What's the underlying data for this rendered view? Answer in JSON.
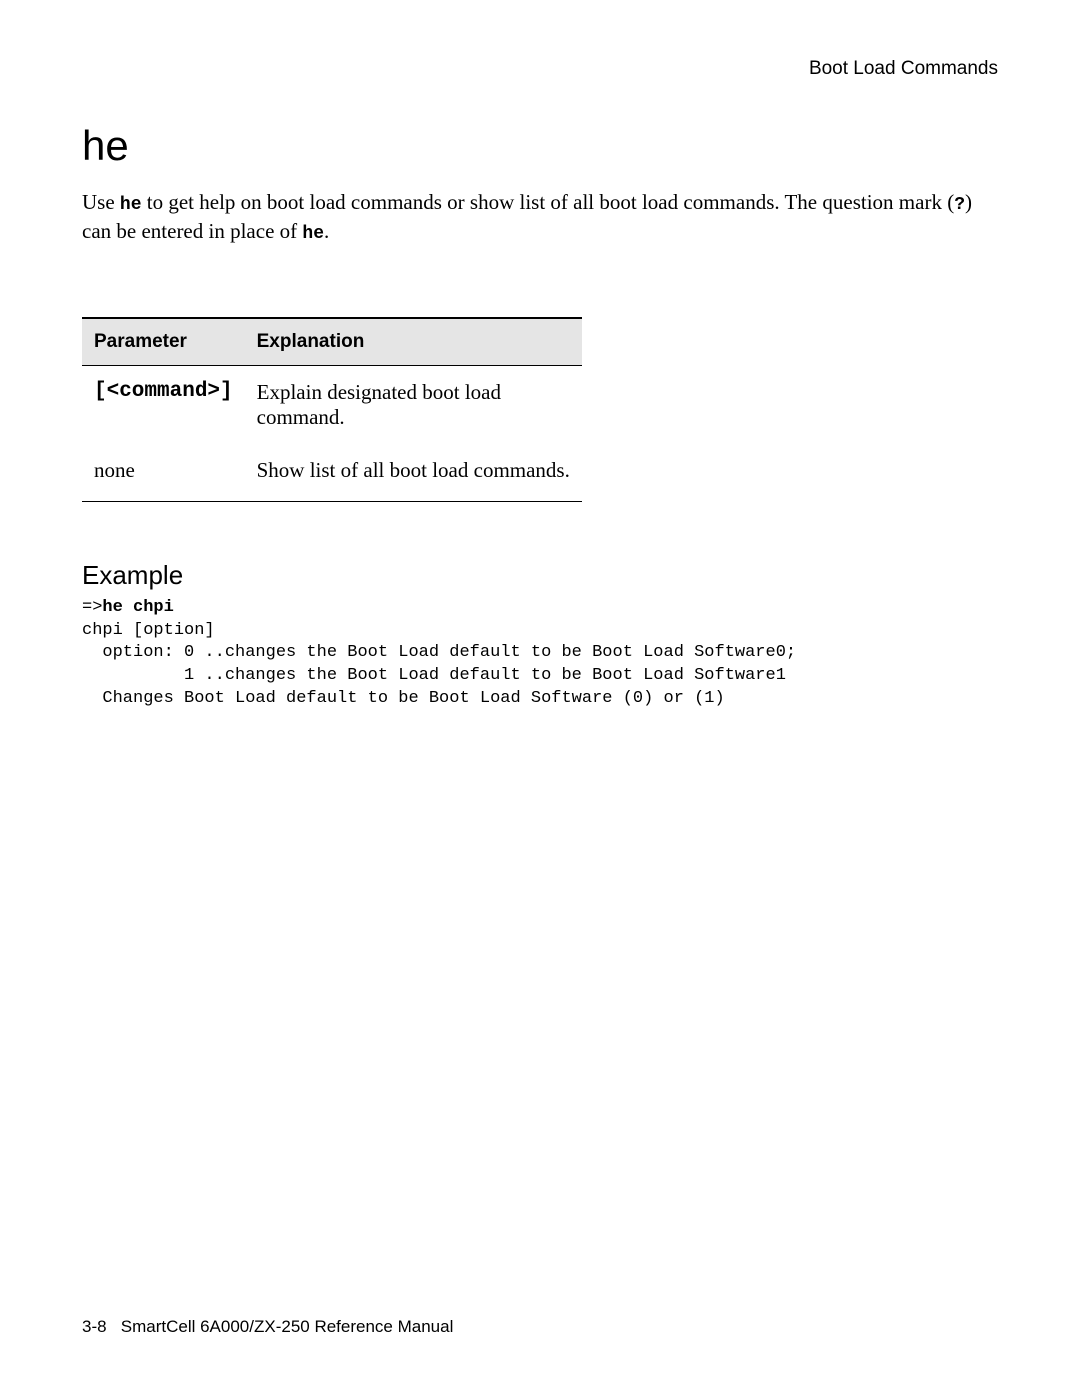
{
  "header": {
    "section": "Boot Load Commands"
  },
  "title": "he",
  "intro": {
    "pre1": "Use ",
    "cmd1": "he",
    "mid1": " to get help on boot load commands or show list of all boot load commands. The question mark (",
    "qmark": "?",
    "mid2": ") can be entered in place of ",
    "cmd2": "he",
    "post": "."
  },
  "table": {
    "headers": {
      "param": "Parameter",
      "explanation": "Explanation"
    },
    "rows": [
      {
        "param": "[<command>]",
        "param_is_mono": true,
        "explanation": "Explain designated boot load command."
      },
      {
        "param": "none",
        "param_is_mono": false,
        "explanation": "Show list of all boot load commands."
      }
    ]
  },
  "example": {
    "heading": "Example",
    "prompt": "=>",
    "command": "he chpi",
    "output": "chpi [option]\n  option: 0 ..changes the Boot Load default to be Boot Load Software0;\n          1 ..changes the Boot Load default to be Boot Load Software1\n  Changes Boot Load default to be Boot Load Software (0) or (1)"
  },
  "footer": {
    "page": "3-8",
    "doc": "SmartCell 6A000/ZX-250 Reference Manual"
  }
}
